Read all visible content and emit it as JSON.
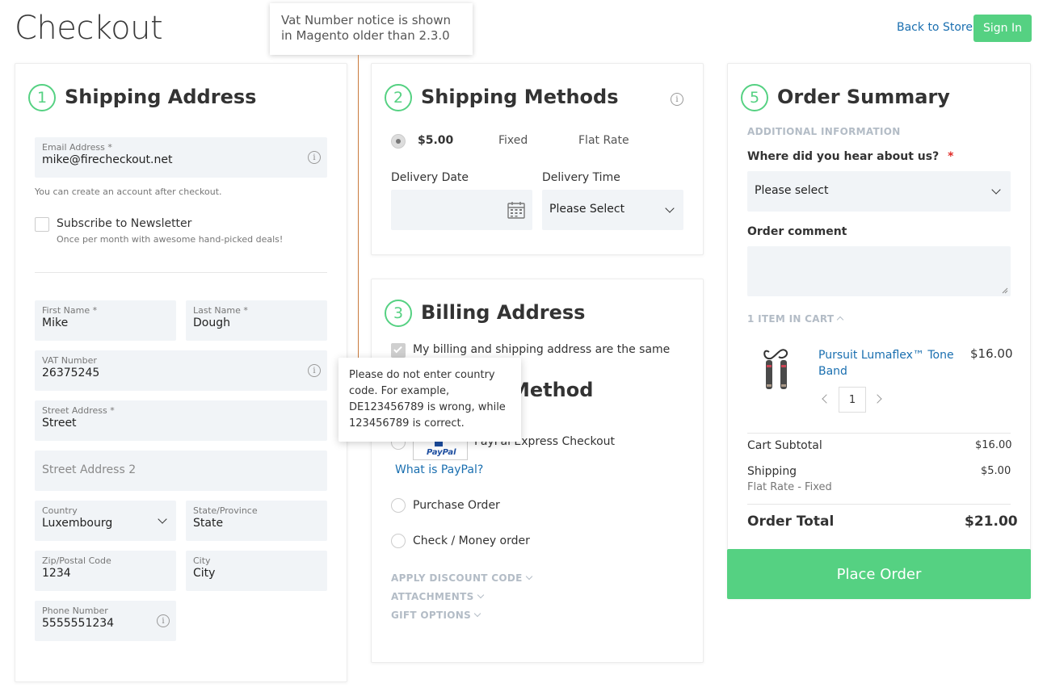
{
  "header": {
    "title": "Checkout",
    "back_link": "Back to Store",
    "sign_in": "Sign In"
  },
  "annotation": {
    "line1": "Vat Number notice is shown",
    "line2": "in Magento older than 2.3.0"
  },
  "shipping_address": {
    "step": "1",
    "title": "Shipping Address",
    "email_label": "Email Address *",
    "email_value": "mike@firecheckout.net",
    "account_note": "You can create an account after checkout.",
    "newsletter_label": "Subscribe to Newsletter",
    "newsletter_hint": "Once per month with awesome hand-picked deals!",
    "first_name_label": "First Name *",
    "first_name_value": "Mike",
    "last_name_label": "Last Name *",
    "last_name_value": "Dough",
    "vat_label": "VAT Number",
    "vat_value": "26375245",
    "street_label": "Street Address *",
    "street_value": "Street",
    "street2_placeholder": "Street Address 2",
    "country_label": "Country",
    "country_value": "Luxembourg",
    "state_label": "State/Province",
    "state_value": "State",
    "zip_label": "Zip/Postal Code",
    "zip_value": "1234",
    "city_label": "City",
    "city_value": "City",
    "phone_label": "Phone Number",
    "phone_value": "5555551234"
  },
  "vat_tooltip": {
    "line1": "Please do not enter country",
    "line2": "code. For example,",
    "line3": "DE123456789 is wrong, while",
    "line4": "123456789 is correct."
  },
  "shipping_methods": {
    "step": "2",
    "title": "Shipping Methods",
    "price": "$5.00",
    "method": "Fixed",
    "carrier": "Flat Rate",
    "delivery_date_label": "Delivery Date",
    "delivery_time_label": "Delivery Time",
    "delivery_time_value": "Please Select"
  },
  "billing": {
    "step": "3",
    "title": "Billing Address",
    "same_label": "My billing and shipping address are the same"
  },
  "payment": {
    "title_partial": "Method",
    "paypal_label": "PayPal Express Checkout",
    "paypal_logo": "PayPal",
    "what_is_paypal": "What is PayPal?",
    "purchase_order": "Purchase Order",
    "check_money": "Check / Money order",
    "discount": "APPLY DISCOUNT CODE",
    "attachments": "ATTACHMENTS",
    "gift": "GIFT OPTIONS"
  },
  "order_summary": {
    "step": "5",
    "title": "Order Summary",
    "additional_info": "ADDITIONAL INFORMATION",
    "hear_label": "Where did you hear about us?",
    "required_star": "*",
    "hear_value": "Please select",
    "comment_label": "Order comment",
    "items_in_cart": "1 ITEM IN CART",
    "product_name_line1": "Pursuit Lumaflex™ Tone",
    "product_name_line2": "Band",
    "product_price": "$16.00",
    "qty": "1",
    "subtotal_label": "Cart Subtotal",
    "subtotal_value": "$16.00",
    "shipping_label": "Shipping",
    "shipping_value": "$5.00",
    "shipping_detail": "Flat Rate - Fixed",
    "total_label": "Order Total",
    "total_value": "$21.00",
    "place_order": "Place Order"
  },
  "colors": {
    "accent": "#55d182",
    "link": "#1a6fb0",
    "field_bg": "#f1f4f7",
    "muted_caps": "#b3bcc6"
  }
}
